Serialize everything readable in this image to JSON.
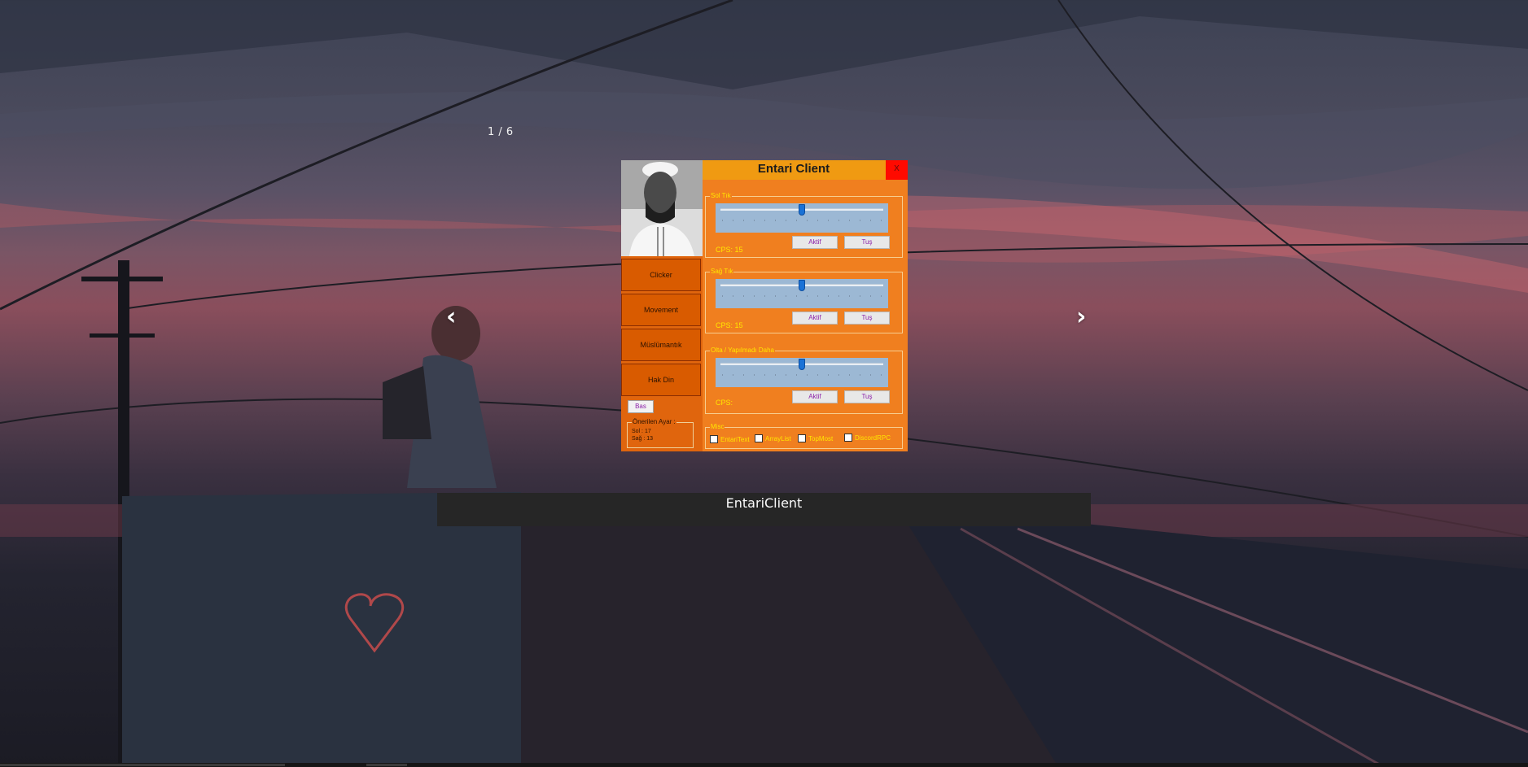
{
  "gallery": {
    "counter": "1 / 6",
    "prev_arrow": "‹",
    "next_arrow": "›",
    "caption": "EntariClient"
  },
  "app": {
    "title": "Entari Client",
    "close_label": "X",
    "menu": [
      "Clicker",
      "Movement",
      "Müslümantık",
      "Hak Din"
    ],
    "bas_label": "Bas",
    "oneri": {
      "legend": "Önerilen Ayar :",
      "lines": [
        "Sol : 17",
        "Sağ : 13"
      ]
    },
    "groups": [
      {
        "title": "Sol Tık",
        "cps": "CPS: 15",
        "slider_value": 0.5,
        "active_label": "Aktif",
        "key_label": "Tuş"
      },
      {
        "title": "Sağ Tık",
        "cps": "CPS: 15",
        "slider_value": 0.5,
        "active_label": "Aktif",
        "key_label": "Tuş"
      },
      {
        "title": "Olta / Yapılmadı Daha",
        "cps": "CPS:",
        "slider_value": 0.5,
        "active_label": "Aktif",
        "key_label": "Tuş"
      }
    ],
    "misc": {
      "title": "Misc",
      "options": [
        "EntariText",
        "ArrayList",
        "TopMost",
        "DiscordRPC"
      ]
    }
  },
  "colors": {
    "window_bg": "#f07f1f",
    "left_panel": "#e0650d",
    "title_bar": "#f09a12",
    "close_button": "#ff0a00",
    "label_yellow": "#ffe600",
    "button_text": "#8c21a8"
  }
}
